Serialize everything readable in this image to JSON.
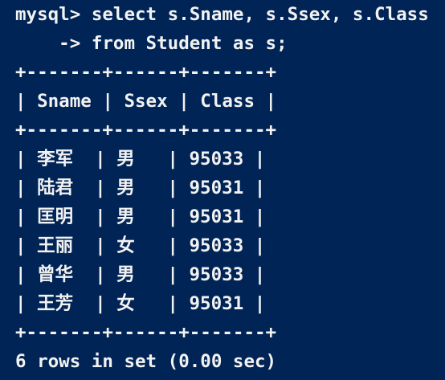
{
  "terminal": {
    "lines": [
      "mysql> select s.Sname, s.Ssex, s.Class",
      "    -> from Student as s;",
      "+-------+------+-------+",
      "| Sname | Ssex | Class |",
      "+-------+------+-------+",
      "| 李军  | 男   | 95033 |",
      "| 陆君  | 男   | 95031 |",
      "| 匡明  | 男   | 95031 |",
      "| 王丽  | 女   | 95033 |",
      "| 曾华  | 男   | 95033 |",
      "| 王芳  | 女   | 95031 |",
      "+-------+------+-------+",
      "6 rows in set (0.00 sec)"
    ]
  }
}
